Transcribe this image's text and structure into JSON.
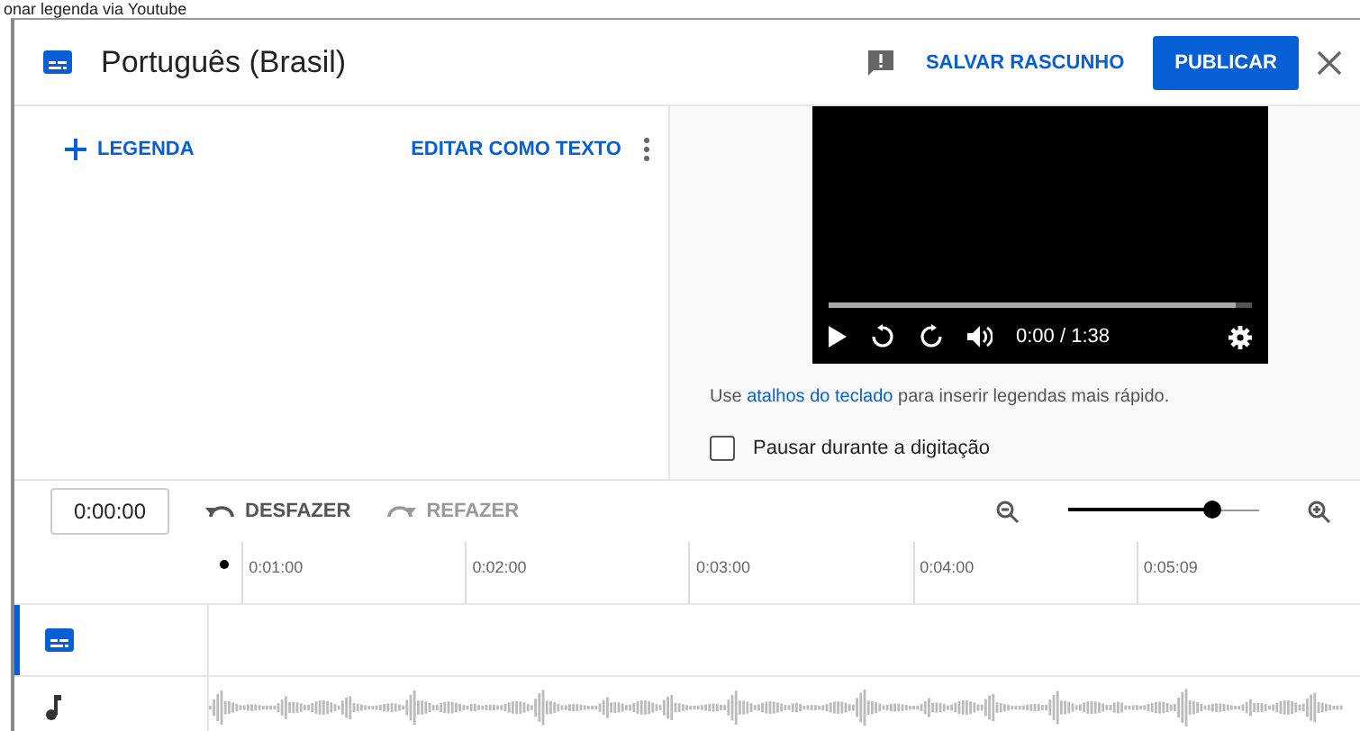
{
  "caption": "onar legenda via Youtube",
  "header": {
    "title": "Português (Brasil)",
    "save_label": "SALVAR RASCUNHO",
    "publish_label": "PUBLICAR"
  },
  "editor": {
    "add_label": "LEGENDA",
    "edit_text_label": "EDITAR COMO TEXTO"
  },
  "player": {
    "progress": {
      "level": 0.96
    },
    "time": "0:00 / 1:38"
  },
  "hint": {
    "before": "Use ",
    "link": "atalhos do teclado",
    "after": " para inserir legendas mais rápido."
  },
  "pause_option": {
    "label": "Pausar durante a digitação",
    "checked": false
  },
  "toolbar": {
    "time": "0:00:00",
    "undo": {
      "label": "DESFAZER",
      "disabled": false
    },
    "redo": {
      "label": "REFAZER",
      "disabled": true
    },
    "zoom": {
      "level": 0.75
    }
  },
  "ruler": [
    "0:01:00",
    "0:02:00",
    "0:03:00",
    "0:04:00",
    "0:05:09"
  ],
  "tracks": [
    {
      "kind": "captions",
      "selected": true
    },
    {
      "kind": "audio",
      "selected": false
    }
  ]
}
